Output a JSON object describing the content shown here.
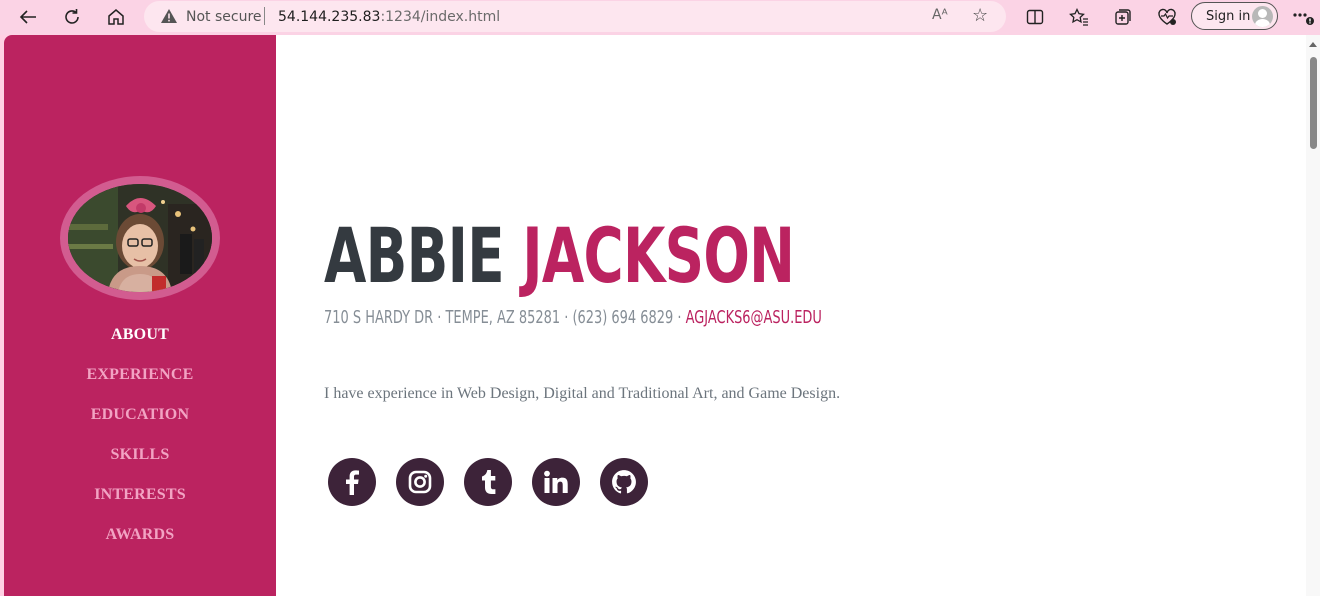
{
  "browser": {
    "security_label": "Not secure",
    "url_host": "54.144.235.83",
    "url_rest": ":1234/index.html",
    "sign_in_label": "Sign in",
    "read_aloud_glyph": "Aᴬ"
  },
  "nav": {
    "items": [
      {
        "label": "ABOUT",
        "active": true
      },
      {
        "label": "EXPERIENCE",
        "active": false
      },
      {
        "label": "EDUCATION",
        "active": false
      },
      {
        "label": "SKILLS",
        "active": false
      },
      {
        "label": "INTERESTS",
        "active": false
      },
      {
        "label": "AWARDS",
        "active": false
      }
    ]
  },
  "profile": {
    "first_name": "ABBIE",
    "last_name": "JACKSON",
    "address": "710 S HARDY DR · TEMPE, AZ 85281 · (623) 694 6829 · ",
    "email": "AGJACKS6@ASU.EDU",
    "lead": "I have experience in Web Design, Digital and Traditional Art, and Game Design."
  },
  "social": [
    {
      "name": "facebook-icon"
    },
    {
      "name": "instagram-icon"
    },
    {
      "name": "tumblr-icon"
    },
    {
      "name": "linkedin-icon"
    },
    {
      "name": "github-icon"
    }
  ],
  "colors": {
    "sidebar": "#bb2360",
    "accent": "#bb2360",
    "heading": "#343a40",
    "social_bg": "#3d2339",
    "toolbar": "#fbd3e5"
  }
}
